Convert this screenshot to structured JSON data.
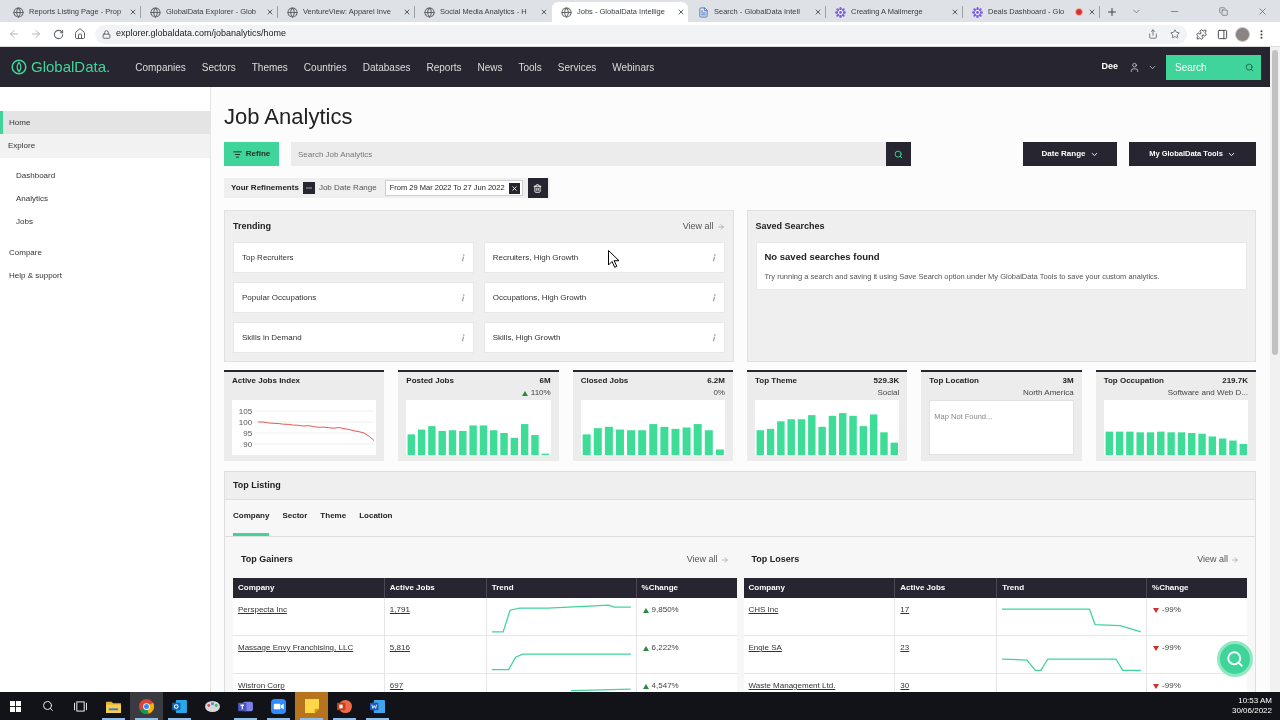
{
  "browser": {
    "tabs": [
      {
        "kind": "page",
        "title": "Reports Listing Page - Prop",
        "selected": false,
        "recording": false
      },
      {
        "kind": "page",
        "title": "GlobalData Explorer - Glob",
        "selected": false,
        "recording": false
      },
      {
        "kind": "page",
        "title": "VentureView: Apparel Inve",
        "selected": false,
        "recording": false
      },
      {
        "kind": "page",
        "title": "Social Media Analytics - H",
        "selected": false,
        "recording": false
      },
      {
        "kind": "page",
        "title": "Jobs - GlobalData Intellige",
        "selected": true,
        "recording": false
      },
      {
        "kind": "doc",
        "title": "Search - GlobalData Intell",
        "selected": false,
        "recording": false
      },
      {
        "kind": "app",
        "title": "Creating A Mailmerge",
        "selected": false,
        "recording": false
      },
      {
        "kind": "app",
        "title": "Deals Dashboard - Glo",
        "selected": false,
        "recording": true
      }
    ],
    "address": "explorer.globaldata.com/jobanalytics/home"
  },
  "navbar": {
    "logo": "GlobalData.",
    "menu": [
      "Companies",
      "Sectors",
      "Themes",
      "Countries",
      "Databases",
      "Reports",
      "News",
      "Tools",
      "Services",
      "Webinars"
    ],
    "user": "Dee",
    "search_label": "Search"
  },
  "sidebar": {
    "items": [
      {
        "label": "Home",
        "selected": true
      },
      {
        "label": "Explore",
        "selected": false,
        "children": [
          {
            "label": "Dashboard",
            "selected": false
          },
          {
            "label": "Analytics",
            "selected": false
          },
          {
            "label": "Jobs",
            "selected": false
          }
        ]
      },
      {
        "label": "Compare",
        "selected": false
      },
      {
        "label": "Help & support",
        "selected": false
      }
    ]
  },
  "header": {
    "title": "Job Analytics",
    "refine": "Refine",
    "search": {
      "placeholder": "Search Job Analytics"
    },
    "menus": [
      "Date Range",
      "My GlobalData Tools"
    ],
    "refinements": {
      "label": "Your Refinements",
      "filter": "Job Date Range",
      "value": "From 29 Mar 2022 To 27 Jun 2022"
    }
  },
  "trending": {
    "title": "Trending",
    "view_all": "View all",
    "items": [
      "Top Recruiters",
      "Recruiters, High Growth",
      "Popular Occupations",
      "Occupations, High Growth",
      "Skills in Demand",
      "Skills, High Growth"
    ]
  },
  "saved_searches": {
    "title": "Saved Searches",
    "empty_title": "No saved searches found",
    "empty_text": "Try running a search and saving it using Save Search option under My GlobalData Tools to save your custom analytics."
  },
  "metrics": [
    {
      "kind": "line",
      "title": "Active Jobs Index",
      "chart_data": {
        "type": "line",
        "grid": true,
        "ylim": [
          85,
          110
        ],
        "yticks": [
          90,
          95,
          100,
          105
        ],
        "series": [
          {
            "color": "#e0453f",
            "values": [
              100,
              100,
              99.6,
              99.4,
              99.3,
              99,
              98.9,
              98.6,
              98.5,
              98.2,
              98.3,
              97.9,
              97.6,
              97.7,
              97.4,
              97.2,
              97.5,
              97,
              96.6,
              96,
              95.6,
              95,
              93.5,
              91.5
            ]
          }
        ]
      }
    },
    {
      "kind": "bars",
      "title": "Posted Jobs",
      "value": "6M",
      "change": "110%",
      "rising": true
    },
    {
      "kind": "bars",
      "title": "Closed Jobs",
      "value": "6.2M",
      "change": "0%"
    },
    {
      "kind": "bars",
      "title": "Top Theme",
      "value": "529.3K",
      "subtitle": "Social"
    },
    {
      "kind": "map",
      "title": "Top Location",
      "value": "3M",
      "subtitle": "North America",
      "message": "Map Not Found..."
    },
    {
      "kind": "bars",
      "title": "Top Occupation",
      "value": "219.7K",
      "subtitle": "Software and Web D..."
    }
  ],
  "top_listing": {
    "title": "Top Listing",
    "tabs": [
      {
        "label": "Company",
        "selected": true
      },
      {
        "label": "Sector",
        "selected": false
      },
      {
        "label": "Theme",
        "selected": false
      },
      {
        "label": "Location",
        "selected": false
      }
    ],
    "tables": [
      {
        "title": "Top Gainers",
        "view_all": "View all",
        "columns": [
          "Company",
          "Active Jobs",
          "Trend",
          "%Change"
        ],
        "rows": [
          {
            "company": "Perspecta Inc",
            "active_jobs": "1,791",
            "change": "9,850%",
            "rising": true
          },
          {
            "company": "Massage Envy Franchising, LLC",
            "active_jobs": "5,816",
            "change": "6,222%",
            "rising": true
          },
          {
            "company": "Wistron Corp",
            "active_jobs": "697",
            "change": "4,547%",
            "rising": true
          }
        ]
      },
      {
        "title": "Top Losers",
        "view_all": "View all",
        "columns": [
          "Company",
          "Active Jobs",
          "Trend",
          "%Change"
        ],
        "rows": [
          {
            "company": "CHS Inc",
            "active_jobs": "17",
            "change": "-99%",
            "rising": false
          },
          {
            "company": "Engie SA",
            "active_jobs": "23",
            "change": "-99%",
            "rising": false
          },
          {
            "company": "Waste Management Ltd.",
            "active_jobs": "30",
            "change": "-99%",
            "rising": false
          }
        ]
      }
    ]
  },
  "taskbar": {
    "apps": [
      {
        "kind": "explorer",
        "running": true,
        "focused": false,
        "attention": false
      },
      {
        "kind": "browser",
        "running": true,
        "focused": true,
        "attention": false
      },
      {
        "kind": "mail",
        "running": true,
        "focused": false,
        "attention": false
      },
      {
        "kind": "paint",
        "running": false,
        "focused": false,
        "attention": false
      },
      {
        "kind": "teams",
        "running": true,
        "focused": false,
        "attention": false
      },
      {
        "kind": "video",
        "running": true,
        "focused": false,
        "attention": false
      },
      {
        "kind": "notes",
        "running": true,
        "focused": false,
        "attention": true
      },
      {
        "kind": "slides",
        "running": true,
        "focused": false,
        "attention": false
      },
      {
        "kind": "word",
        "running": true,
        "focused": false,
        "attention": false
      }
    ],
    "time": "10:53 AM",
    "date": "30/06/2022"
  }
}
